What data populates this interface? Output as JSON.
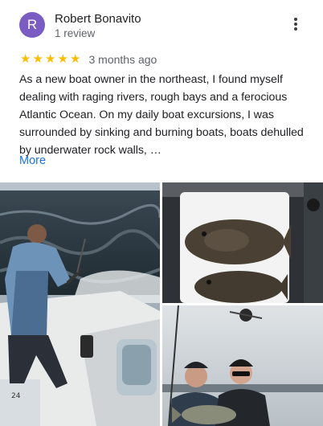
{
  "reviewer": {
    "initial": "R",
    "name": "Robert Bonavito",
    "review_count": "1 review",
    "avatar_color": "#7b5cc3"
  },
  "rating": {
    "stars": 5,
    "max_stars": 5,
    "date": "3 months ago",
    "star_color": "#fbbc04"
  },
  "review": {
    "lines": [
      "As a new boat owner in the northeast, I found myself",
      "dealing with raging rivers, rough bays and a ferocious",
      "Atlantic Ocean. On my daily boat excursions, I was",
      "surrounded by sinking and burning boats, boats dehulled",
      "by underwater rock walls, …"
    ],
    "more_label": "More"
  },
  "menu": {
    "icon": "more-vert-icon"
  },
  "photos": [
    {
      "name": "photo-boat-fishing"
    },
    {
      "name": "photo-flounder-catch"
    },
    {
      "name": "photo-anglers-with-fish"
    }
  ]
}
